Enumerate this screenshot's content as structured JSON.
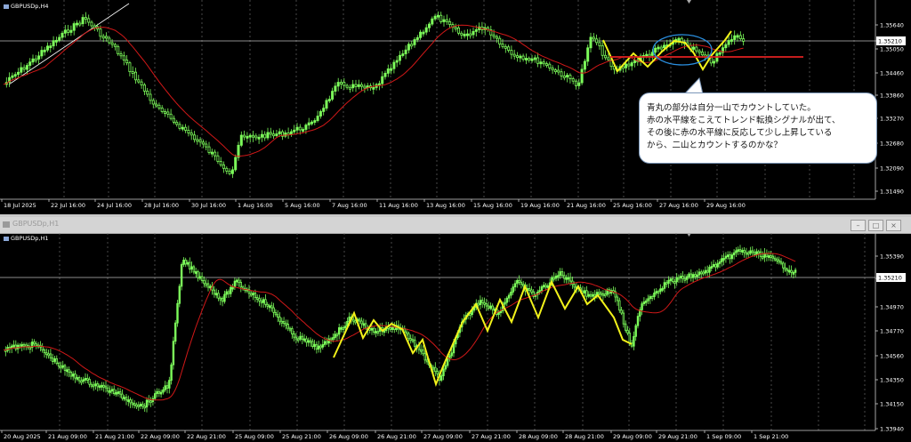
{
  "top": {
    "symbol": "GBPUSDp,H4",
    "price_labels": [
      "1.35640",
      "1.35210",
      "1.35050",
      "1.34460",
      "1.33860",
      "1.33270",
      "1.32680",
      "1.32090",
      "1.31490"
    ],
    "current_price": "1.35210",
    "time_labels": [
      "18 Jul 2025",
      "22 Jul 16:00",
      "24 Jul 16:00",
      "28 Jul 16:00",
      "30 Jul 16:00",
      "1 Aug 16:00",
      "5 Aug 16:00",
      "7 Aug 16:00",
      "11 Aug 16:00",
      "13 Aug 16:00",
      "15 Aug 16:00",
      "19 Aug 16:00",
      "21 Aug 16:00",
      "25 Aug 16:00",
      "27 Aug 16:00",
      "29 Aug 16:00"
    ]
  },
  "bottom": {
    "window_title": "GBPUSDp,H1",
    "symbol": "GBPUSDp,H1",
    "price_labels": [
      "1.35390",
      "1.35210",
      "1.34970",
      "1.34770",
      "1.34560",
      "1.34350",
      "1.34150",
      "1.33940"
    ],
    "current_price": "1.35210",
    "time_labels": [
      "20 Aug 2025",
      "21 Aug 09:00",
      "21 Aug 21:00",
      "22 Aug 09:00",
      "22 Aug 21:00",
      "25 Aug 09:00",
      "25 Aug 21:00",
      "26 Aug 09:00",
      "26 Aug 21:00",
      "27 Aug 09:00",
      "27 Aug 21:00",
      "28 Aug 09:00",
      "28 Aug 21:00",
      "29 Aug 09:00",
      "29 Aug 21:00",
      "1 Sep 09:00",
      "1 Sep 21:00"
    ]
  },
  "callout": {
    "lines": [
      "青丸の部分は自分一山でカウントしていた。",
      "赤の水平線をこえてトレンド転換シグナルが出て、",
      "その後に赤の水平線に反応して少し上昇している",
      "から、二山とカウントするのかな？"
    ]
  },
  "colors": {
    "candle": "#7cfc5a",
    "ma": "#d01818",
    "zigzag": "#f2f21a",
    "hline": "#e02020",
    "circle": "#2a8fe0"
  }
}
